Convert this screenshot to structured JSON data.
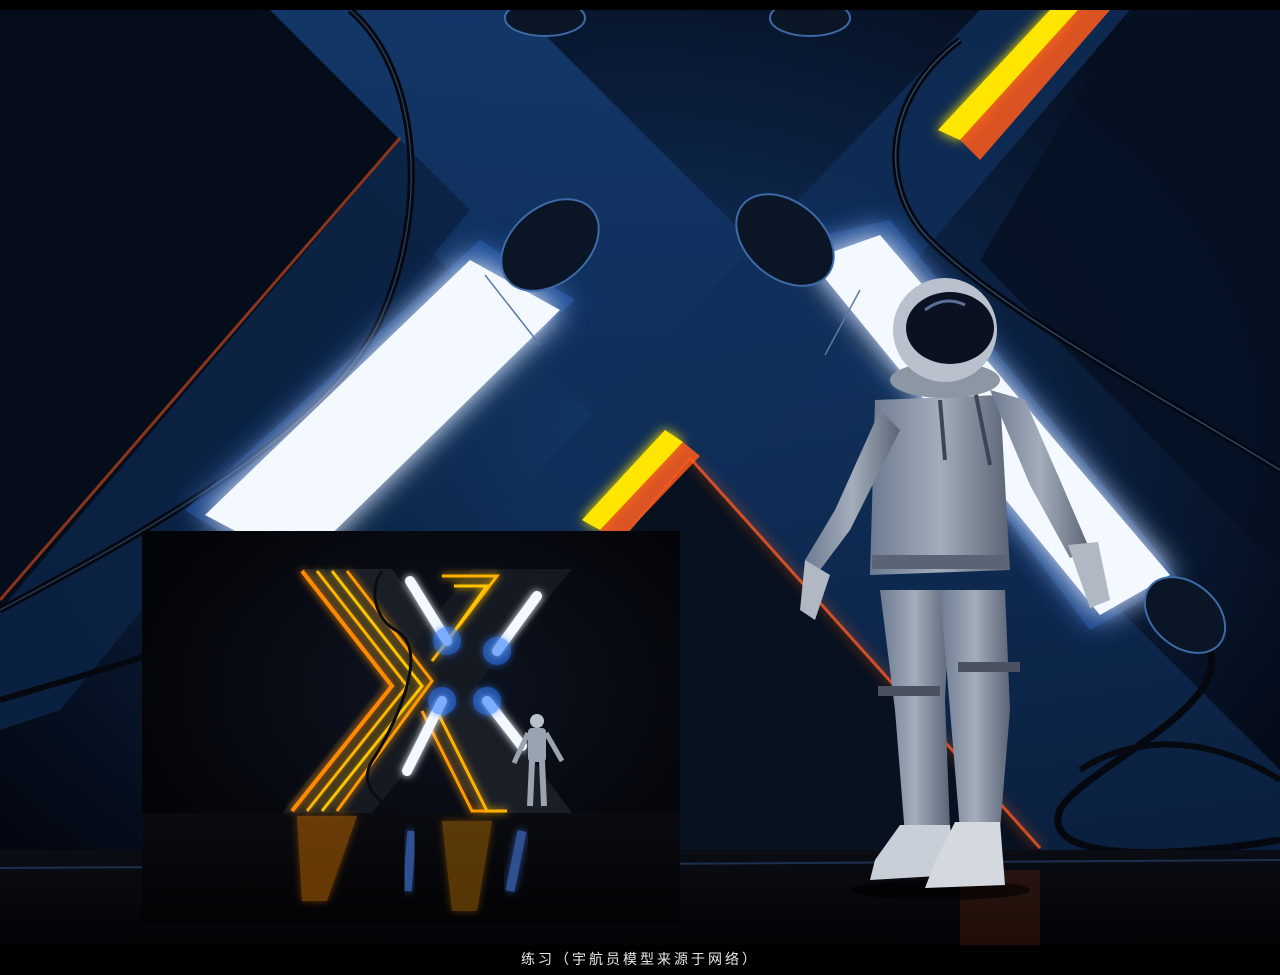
{
  "caption": "练习（宇航员模型来源于网络）",
  "colors": {
    "background": "#06101f",
    "panel_blue": "#0e2a52",
    "neon_white": "#f4f8ff",
    "neon_blue_glow": "#2f7bff",
    "neon_yellow": "#ffe600",
    "neon_orange": "#ff5a1a",
    "suit_grey": "#8d96a3"
  }
}
